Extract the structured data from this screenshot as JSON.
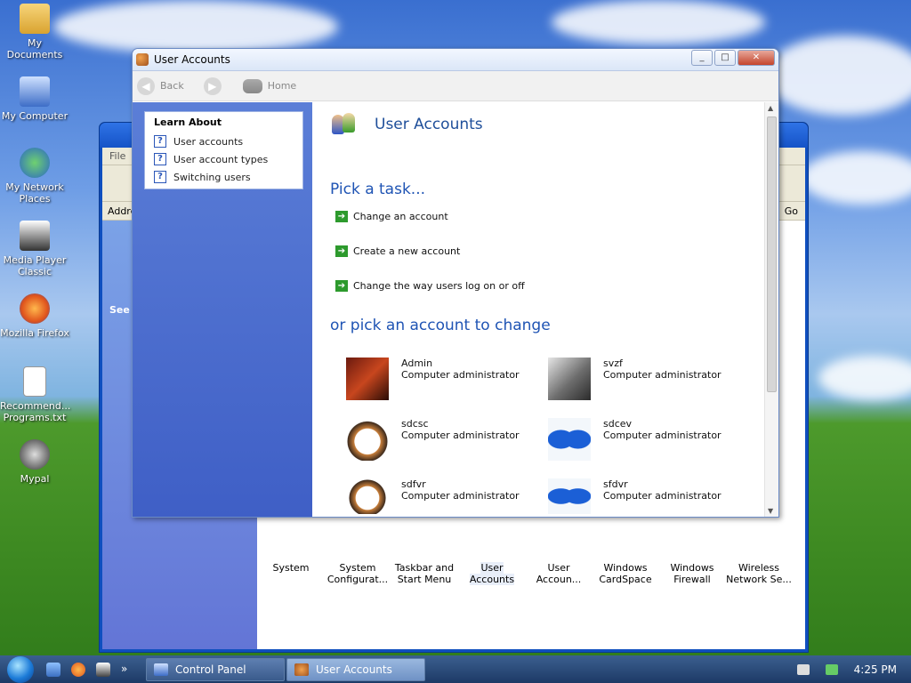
{
  "desktop_icons": [
    {
      "label": "My Documents"
    },
    {
      "label": "My Computer"
    },
    {
      "label": "My Network Places"
    },
    {
      "label": "Media Player Classic"
    },
    {
      "label": "Mozilla Firefox"
    },
    {
      "label": "Recommend... Programs.txt"
    },
    {
      "label": "Mypal"
    }
  ],
  "control_panel": {
    "menu_label": "File",
    "address_label": "Addre",
    "go_label": "Go",
    "sidebar_see_also": "See A",
    "applets": [
      {
        "label": "System"
      },
      {
        "label": "System Configurat..."
      },
      {
        "label": "Taskbar and Start Menu"
      },
      {
        "label": "User Accounts"
      },
      {
        "label": "User Accoun..."
      },
      {
        "label": "Windows CardSpace"
      },
      {
        "label": "Windows Firewall"
      },
      {
        "label": "Wireless Network Se..."
      }
    ]
  },
  "window": {
    "title": "User Accounts",
    "toolbar": {
      "back": "Back",
      "home": "Home"
    },
    "learn_about": {
      "title": "Learn About",
      "items": [
        "User accounts",
        "User account types",
        "Switching users"
      ]
    },
    "page_title": "User Accounts",
    "pick_task_heading": "Pick a task...",
    "tasks": [
      "Change an account",
      "Create a new account",
      "Change the way users log on or off"
    ],
    "pick_account_heading": "or pick an account to change",
    "accounts": [
      {
        "name": "Admin",
        "role": "Computer administrator",
        "picture": "chess"
      },
      {
        "name": "svzf",
        "role": "Computer administrator",
        "picture": "horse"
      },
      {
        "name": "sdcsc",
        "role": "Computer administrator",
        "picture": "dog"
      },
      {
        "name": "sdcev",
        "role": "Computer administrator",
        "picture": "butterfly"
      },
      {
        "name": "sdfvr",
        "role": "Computer administrator",
        "picture": "dog"
      },
      {
        "name": "sfdvr",
        "role": "Computer administrator",
        "picture": "butterfly"
      }
    ]
  },
  "taskbar": {
    "tasks": [
      {
        "label": "Control Panel",
        "active": false
      },
      {
        "label": "User Accounts",
        "active": true
      }
    ],
    "clock": "4:25 PM"
  }
}
